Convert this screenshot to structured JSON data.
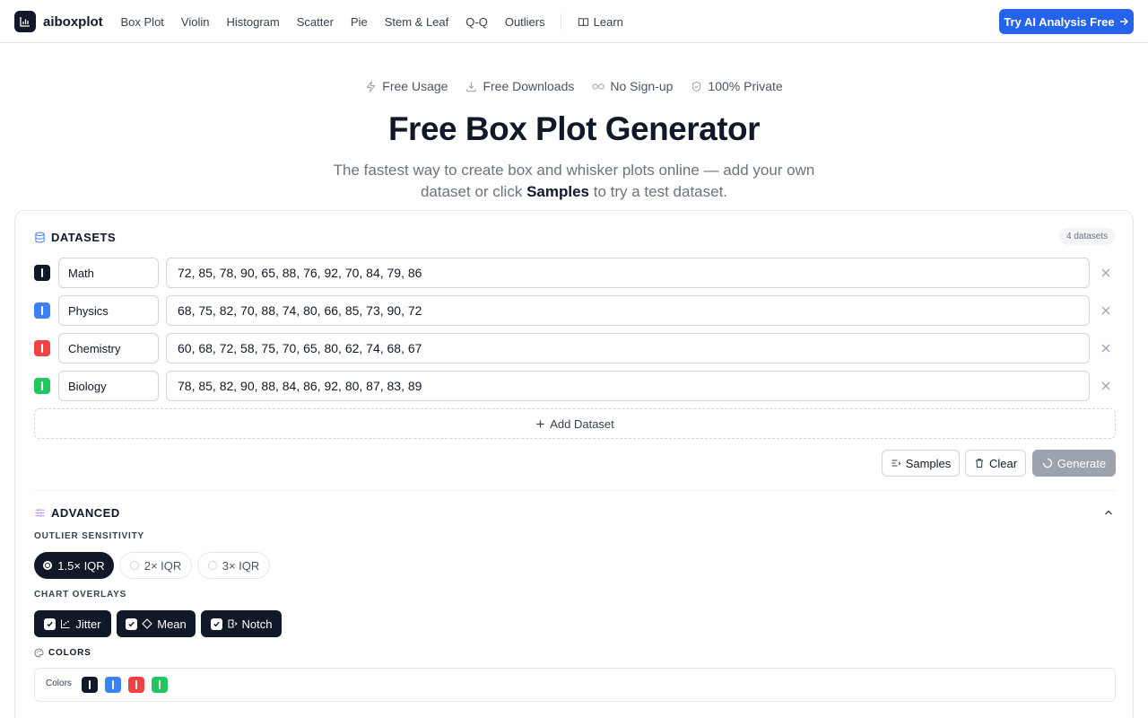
{
  "nav": {
    "logo": "aiboxplot",
    "links": [
      "Box Plot",
      "Violin",
      "Histogram",
      "Scatter",
      "Pie",
      "Stem & Leaf",
      "Q-Q",
      "Outliers"
    ],
    "learn": "Learn",
    "cta": "Try AI Analysis Free"
  },
  "hero": {
    "features": [
      "Free Usage",
      "Free Downloads",
      "No Sign-up",
      "100% Private"
    ],
    "title": "Free Box Plot Generator",
    "subtitle_line1": "The fastest way to create box and whisker plots online — add your own",
    "subtitle_pre": "dataset or click ",
    "subtitle_bold": "Samples",
    "subtitle_post": " to try a test dataset."
  },
  "datasets": {
    "heading": "DATASETS",
    "count": "4 datasets",
    "rows": [
      {
        "name": "Math",
        "values": "72, 85, 78, 90, 65, 88, 76, 92, 70, 84, 79, 86",
        "color": "#111827"
      },
      {
        "name": "Physics",
        "values": "68, 75, 82, 70, 88, 74, 80, 66, 85, 73, 90, 72",
        "color": "#3b82f6"
      },
      {
        "name": "Chemistry",
        "values": "60, 68, 72, 58, 75, 70, 65, 80, 62, 74, 68, 67",
        "color": "#ef4444"
      },
      {
        "name": "Biology",
        "values": "78, 85, 82, 90, 88, 84, 86, 92, 80, 87, 83, 89",
        "color": "#22c55e"
      }
    ],
    "add_label": "Add Dataset"
  },
  "actions": {
    "samples": "Samples",
    "clear": "Clear",
    "generate": "Generate"
  },
  "advanced": {
    "heading": "ADVANCED",
    "sensitivity_label": "OUTLIER SENSITIVITY",
    "sensitivity_options": [
      "1.5× IQR",
      "2× IQR",
      "3× IQR"
    ],
    "sensitivity_selected": "1.5× IQR",
    "overlays_label": "CHART OVERLAYS",
    "overlays": [
      "Jitter",
      "Mean",
      "Notch"
    ],
    "colors_heading": "COLORS",
    "colors_label": "Colors",
    "colors": [
      "#111827",
      "#3b82f6",
      "#ef4444",
      "#22c55e"
    ]
  }
}
